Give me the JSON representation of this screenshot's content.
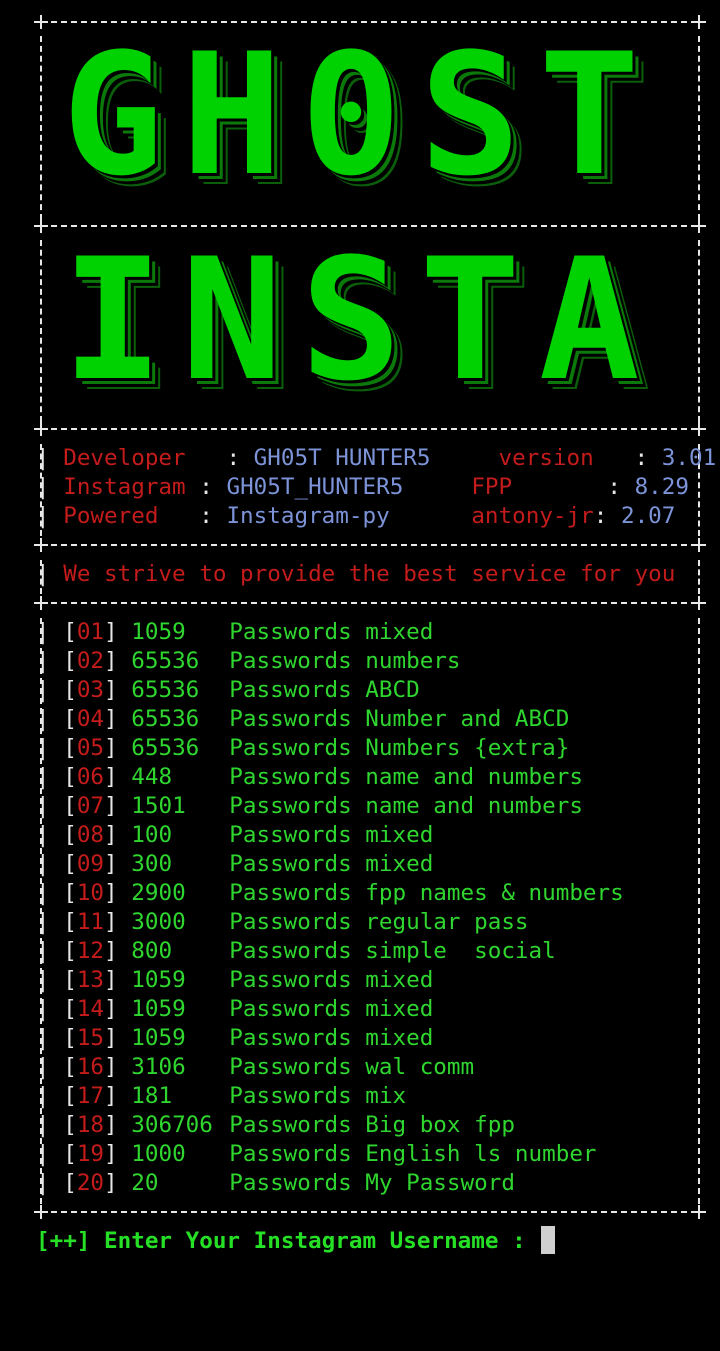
{
  "banner": {
    "line1": "GH0ST",
    "line2": "INSTA"
  },
  "info": {
    "rows": [
      {
        "k1": "Developer",
        "v1": "GH05T HUNTER5",
        "k2": "version",
        "v2": "3.01"
      },
      {
        "k1": "Instagram",
        "v1": "GH05T_HUNTER5",
        "k2": "FPP",
        "v2": "8.29"
      },
      {
        "k1": "Powered",
        "v1": "Instagram-py",
        "k2": "antony-jr",
        "v2": "2.07"
      }
    ]
  },
  "tagline": "We strive to provide the best service for you",
  "menu": [
    {
      "num": "01",
      "count": "1059",
      "desc": "Passwords mixed"
    },
    {
      "num": "02",
      "count": "65536",
      "desc": "Passwords numbers"
    },
    {
      "num": "03",
      "count": "65536",
      "desc": "Passwords ABCD"
    },
    {
      "num": "04",
      "count": "65536",
      "desc": "Passwords Number and ABCD"
    },
    {
      "num": "05",
      "count": "65536",
      "desc": "Passwords Numbers {extra}"
    },
    {
      "num": "06",
      "count": "448",
      "desc": "Passwords name and numbers"
    },
    {
      "num": "07",
      "count": "1501",
      "desc": "Passwords name and numbers"
    },
    {
      "num": "08",
      "count": "100",
      "desc": "Passwords mixed"
    },
    {
      "num": "09",
      "count": "300",
      "desc": "Passwords mixed"
    },
    {
      "num": "10",
      "count": "2900",
      "desc": "Passwords fpp names & numbers"
    },
    {
      "num": "11",
      "count": "3000",
      "desc": "Passwords regular pass"
    },
    {
      "num": "12",
      "count": "800",
      "desc": "Passwords simple  social"
    },
    {
      "num": "13",
      "count": "1059",
      "desc": "Passwords mixed"
    },
    {
      "num": "14",
      "count": "1059",
      "desc": "Passwords mixed"
    },
    {
      "num": "15",
      "count": "1059",
      "desc": "Passwords mixed"
    },
    {
      "num": "16",
      "count": "3106",
      "desc": "Passwords wal comm"
    },
    {
      "num": "17",
      "count": "181",
      "desc": "Passwords mix"
    },
    {
      "num": "18",
      "count": "306706",
      "desc": "Passwords Big box fpp"
    },
    {
      "num": "19",
      "count": "1000",
      "desc": "Passwords English ls number"
    },
    {
      "num": "20",
      "count": "20",
      "desc": "Passwords My Password"
    }
  ],
  "prompt": {
    "label": "[++] Enter Your Instagram Username : "
  },
  "colors": {
    "accent": "#00d100",
    "key": "#c41b1b",
    "value": "#7c93d8",
    "text": "#2fd62f"
  }
}
